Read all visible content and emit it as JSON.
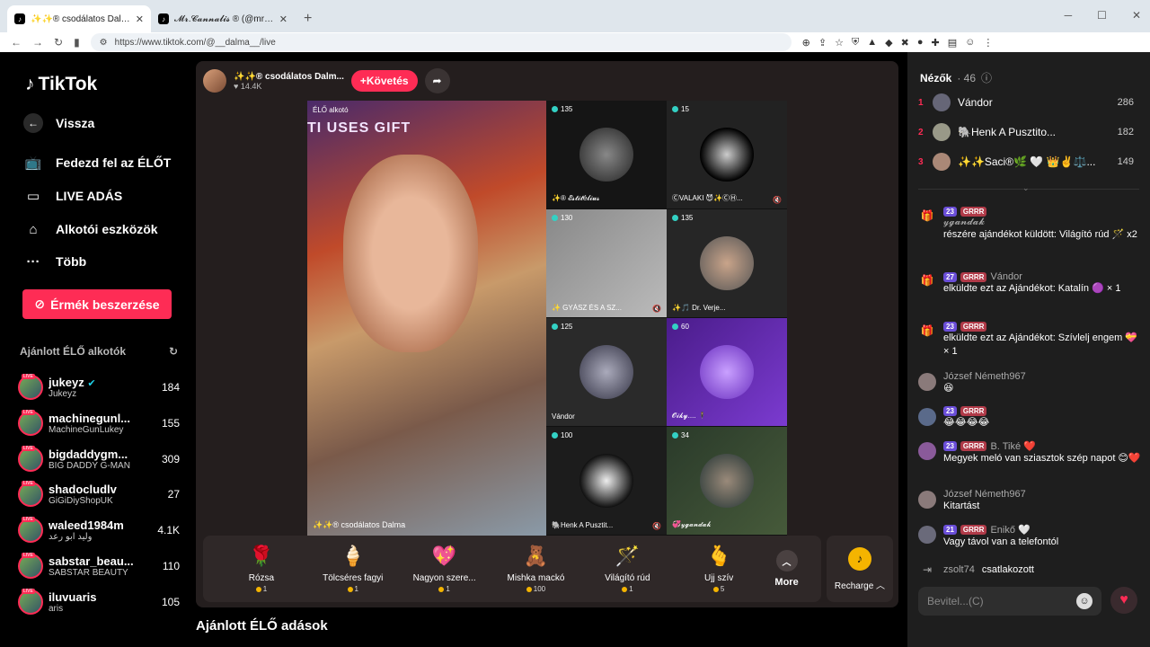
{
  "browser": {
    "tabs": [
      {
        "title": "✨✨® csodálatos Dalma",
        "active": true
      },
      {
        "title": "𝓜𝓻.𝓒𝓪𝓷𝓷𝓪𝓵𝓲𝓼 ® (@mrcannabis_)",
        "active": false
      }
    ],
    "url": "https://www.tiktok.com/@__dalma__/live"
  },
  "sidebar": {
    "logo": "TikTok",
    "nav": [
      {
        "label": "Vissza",
        "icon": "back-arrow-icon"
      },
      {
        "label": "Fedezd fel az ÉLŐT",
        "icon": "live-tv-icon"
      },
      {
        "label": "LIVE ADÁS",
        "icon": "video-camera-icon"
      },
      {
        "label": "Alkotói eszközök",
        "icon": "creator-tools-icon"
      },
      {
        "label": "Több",
        "icon": "more-dots-icon"
      }
    ],
    "coins_button": "Érmék beszerzése",
    "recommended_title": "Ajánlott ÉLŐ alkotók",
    "creators": [
      {
        "name": "jukeyz",
        "sub": "Jukeyz",
        "count": "184",
        "verified": true
      },
      {
        "name": "machinegunl...",
        "sub": "MachineGunLukey",
        "count": "155"
      },
      {
        "name": "bigdaddygm...",
        "sub": "BIG DADDY G-MAN",
        "count": "309"
      },
      {
        "name": "shadocludlv",
        "sub": "GiGiDiyShopUK",
        "count": "27"
      },
      {
        "name": "waleed1984m",
        "sub": "وليد ابو رعد",
        "count": "4.1K"
      },
      {
        "name": "sabstar_beau...",
        "sub": "SABSTAR BEAUTY",
        "count": "110"
      },
      {
        "name": "iluvuaris",
        "sub": "aris",
        "count": "105"
      }
    ],
    "live_badge": "LIVE"
  },
  "stream": {
    "host_name": "✨✨® csodálatos Dalm...",
    "host_likes": "14.4K",
    "follow": "+Követés",
    "host_tag": "ÉLŐ alkotó",
    "host_banner": "TI         USES GIFT",
    "host_footer": "✨✨® csodálatos Dalma",
    "guests": [
      {
        "count": "135",
        "label": "✨® 𝓔𝓼𝓽𝓲𝓽é𝓵𝓲𝓾𝓼",
        "muted": false
      },
      {
        "count": "15",
        "label": "ⒸVALAKI 😈✨ⒸⒽ...",
        "muted": true
      },
      {
        "count": "130",
        "label": "✨ GYÁSZ ÉS A SZ...",
        "muted": true
      },
      {
        "count": "135",
        "label": "✨🎵 Dr. Verje...",
        "muted": false
      },
      {
        "count": "125",
        "label": "Vándor",
        "muted": false
      },
      {
        "count": "60",
        "label": "𝓞𝓲𝓴𝔂.... 🕴",
        "muted": false
      },
      {
        "count": "100",
        "label": "🐘Henk A Pusztit...",
        "muted": true
      },
      {
        "count": "34",
        "label": "💞𝓎𝓰𝓪𝓷𝓭𝓪𝓴",
        "muted": false
      }
    ],
    "gifts": [
      {
        "name": "Rózsa",
        "price": "1",
        "icon": "🌹"
      },
      {
        "name": "Tölcséres fagyi",
        "price": "1",
        "icon": "🍦"
      },
      {
        "name": "Nagyon szere...",
        "price": "1",
        "icon": "💖"
      },
      {
        "name": "Mishka mackó",
        "price": "100",
        "icon": "🧸"
      },
      {
        "name": "Világító rúd",
        "price": "1",
        "icon": "🪄"
      },
      {
        "name": "Ujj szív",
        "price": "5",
        "icon": "🫰"
      }
    ],
    "more": "More",
    "recharge": "Recharge",
    "suggested": "Ajánlott ÉLŐ adások"
  },
  "chat": {
    "viewers_label": "Nézők",
    "viewers_count": "· 46",
    "top": [
      {
        "rank": "1",
        "name": "Vándor",
        "score": "286"
      },
      {
        "rank": "2",
        "name": "🐘Henk A Pusztito...",
        "score": "182"
      },
      {
        "rank": "3",
        "name": "✨✨Saci®🌿 🤍 👑✌️⚖️...",
        "score": "149"
      }
    ],
    "messages": [
      {
        "lvl": "23",
        "fan": "GRRR",
        "user": "𝓎𝓰𝓪𝓷𝓭𝓪𝓴",
        "text": "részére ajándékot küldött: Világító rúd 🪄 x2",
        "gift": true
      },
      {
        "lvl": "27",
        "fan": "GRRR",
        "user": "Vándor",
        "text": "elküldte ezt az Ajándékot: Katalín 🟣 × 1",
        "gift": true
      },
      {
        "lvl": "23",
        "fan": "GRRR",
        "user": "",
        "text": "elküldte ezt az Ajándékot: Szívlelj engem 💝 × 1",
        "gift": true
      },
      {
        "lvl": "",
        "fan": "",
        "user": "József Németh967",
        "text": "😆",
        "gift": false
      },
      {
        "lvl": "23",
        "fan": "GRRR",
        "user": "",
        "text": "😂😂😂😂",
        "gift": false
      },
      {
        "lvl": "23",
        "fan": "GRRR",
        "user": "B. Tiké ❤️",
        "text": "Megyek meló van sziasztok szép napot 😊❤️",
        "gift": false
      },
      {
        "lvl": "",
        "fan": "",
        "user": "József Németh967",
        "text": "Kitartást",
        "gift": false
      },
      {
        "lvl": "21",
        "fan": "GRRR",
        "user": "Enikő 🤍",
        "text": "Vagy távol van a telefontól",
        "gift": false
      }
    ],
    "joined_user": "zsolt74",
    "joined_text": "csatlakozott",
    "input_placeholder": "Bevitel...(C)"
  }
}
